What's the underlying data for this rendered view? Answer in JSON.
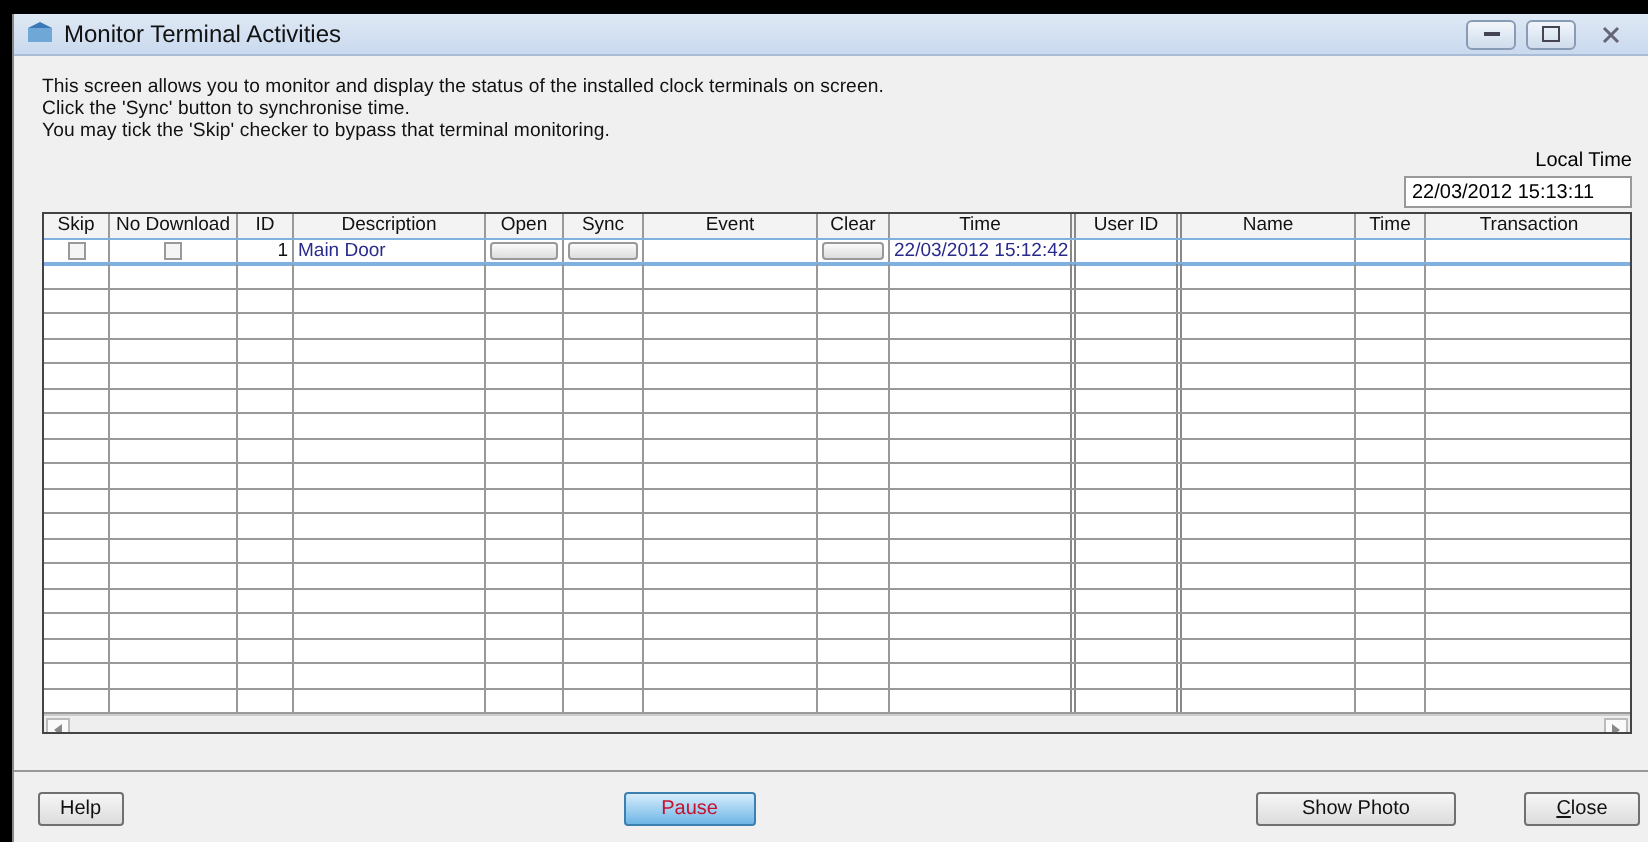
{
  "window": {
    "title": "Monitor Terminal Activities"
  },
  "instructions": [
    "This screen allows you to monitor and display the status of the installed clock terminals on screen.",
    "Click the 'Sync' button to synchronise time.",
    "You may tick the 'Skip' checker to bypass that terminal monitoring."
  ],
  "local_time": {
    "label": "Local Time",
    "value": "22/03/2012 15:13:11"
  },
  "table": {
    "columns": [
      "Skip",
      "No Download",
      "ID",
      "Description",
      "Open",
      "Sync",
      "Event",
      "Clear",
      "Time",
      "User ID",
      "Name",
      "Time",
      "Transaction"
    ],
    "rows": [
      {
        "skip": false,
        "no_download": false,
        "id": "1",
        "description": "Main Door",
        "time": "22/03/2012 15:12:42",
        "selected": true
      }
    ]
  },
  "buttons": [
    {
      "label": "Help",
      "default": false
    },
    {
      "label": "Pause",
      "default": true
    },
    {
      "label": "Show Photo",
      "default": false
    },
    {
      "label": "Close",
      "default": false
    }
  ]
}
